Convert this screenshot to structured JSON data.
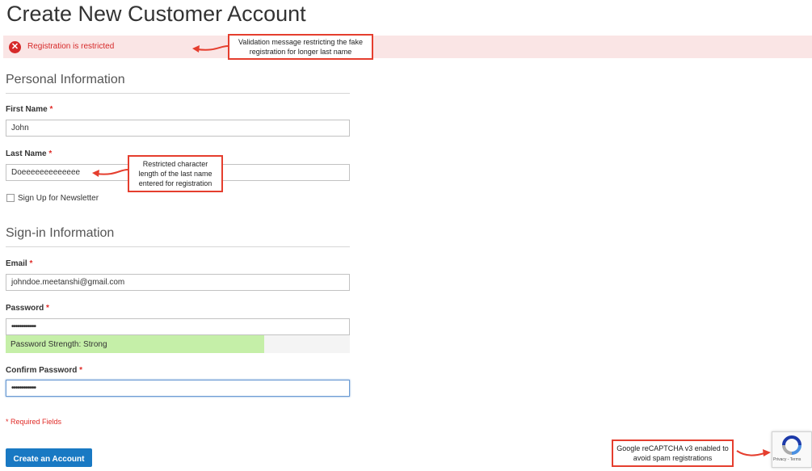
{
  "page": {
    "title": "Create New Customer Account"
  },
  "error": {
    "message": "Registration is restricted",
    "icon": "error-circle-icon",
    "color": "#d62929"
  },
  "personal": {
    "heading": "Personal Information",
    "first_name": {
      "label": "First Name",
      "required_mark": "*",
      "value": "John"
    },
    "last_name": {
      "label": "Last Name",
      "required_mark": "*",
      "value": "Doeeeeeeeeeeeee"
    },
    "newsletter": {
      "label": "Sign Up for Newsletter",
      "checked": false
    }
  },
  "signin": {
    "heading": "Sign-in Information",
    "email": {
      "label": "Email",
      "required_mark": "*",
      "value": "johndoe.meetanshi@gmail.com"
    },
    "password": {
      "label": "Password",
      "required_mark": "*",
      "value": "••••••••••••"
    },
    "strength": {
      "text": "Password Strength: Strong",
      "level": 0.75,
      "color": "#c5efa8"
    },
    "confirm": {
      "label": "Confirm Password",
      "required_mark": "*",
      "value": "••••••••••••"
    }
  },
  "required_note": "* Required Fields",
  "submit": {
    "label": "Create an Account",
    "color": "#1979c3"
  },
  "annotations": {
    "validation": "Validation message restricting the fake registration for longer last name",
    "lastname": "Restricted character length of the last name entered for registration",
    "recaptcha": "Google reCAPTCHA v3 enabled to avoid spam registrations",
    "border_color": "#e53e2e"
  },
  "recaptcha": {
    "terms": "Privacy - Terms",
    "icon": "recaptcha-logo-icon"
  }
}
